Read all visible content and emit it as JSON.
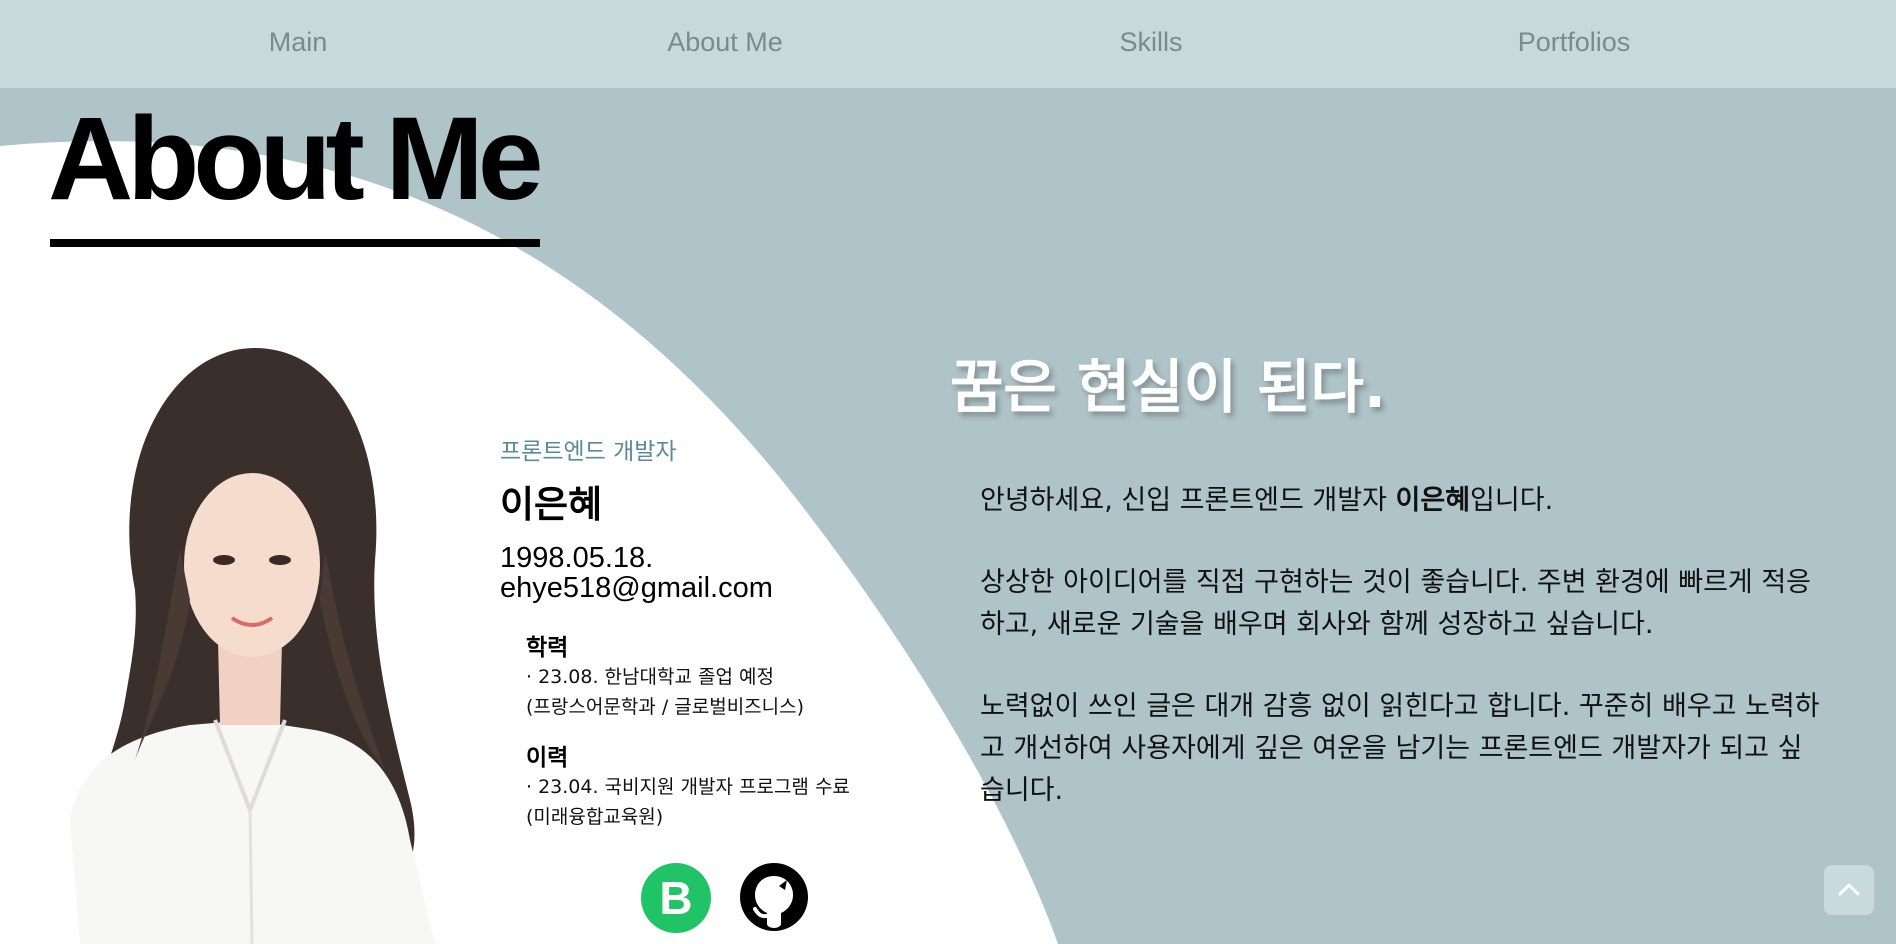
{
  "nav": {
    "items": [
      "Main",
      "About Me",
      "Skills",
      "Portfolios"
    ]
  },
  "page_title": "About Me",
  "profile": {
    "role": "프론트엔드 개발자",
    "name": "이은혜",
    "birth": "1998.05.18.",
    "email": "ehye518@gmail.com",
    "education": {
      "title": "학력",
      "line1": "· 23.08. 한남대학교 졸업 예정",
      "line2": "(프랑스어문학과 / 글로벌비즈니스)"
    },
    "career": {
      "title": "이력",
      "line1": "· 23.04. 국비지원 개발자 프로그램 수료",
      "line2": "(미래융합교육원)"
    },
    "links": {
      "blog_letter": "B",
      "blog_icon": "blog-icon",
      "github_icon": "github-icon"
    }
  },
  "intro": {
    "slogan": "꿈은 현실이 된다.",
    "p1_before": "안녕하세요, 신입 프론트엔드 개발자 ",
    "p1_name": "이은혜",
    "p1_after": "입니다.",
    "p2": "상상한 아이디어를 직접 구현하는 것이 좋습니다. 주변 환경에 빠르게 적응하고, 새로운 기술을 배우며 회사와 함께 성장하고 싶습니다.",
    "p3": "노력없이 쓰인 글은 대개 감흥 없이 읽힌다고 합니다. 꾸준히 배우고 노력하고 개선하여 사용자에게 깊은 여운을 남기는 프론트엔드 개발자가 되고 싶습니다."
  },
  "scroll_top_icon": "chevron-up-icon",
  "colors": {
    "background": "#afc4c8",
    "nav_background": "#c7d9db",
    "nav_text": "#7a8b8f",
    "role_text": "#5a8a98",
    "blog_badge": "#20c466",
    "slogan": "#ffffff"
  }
}
